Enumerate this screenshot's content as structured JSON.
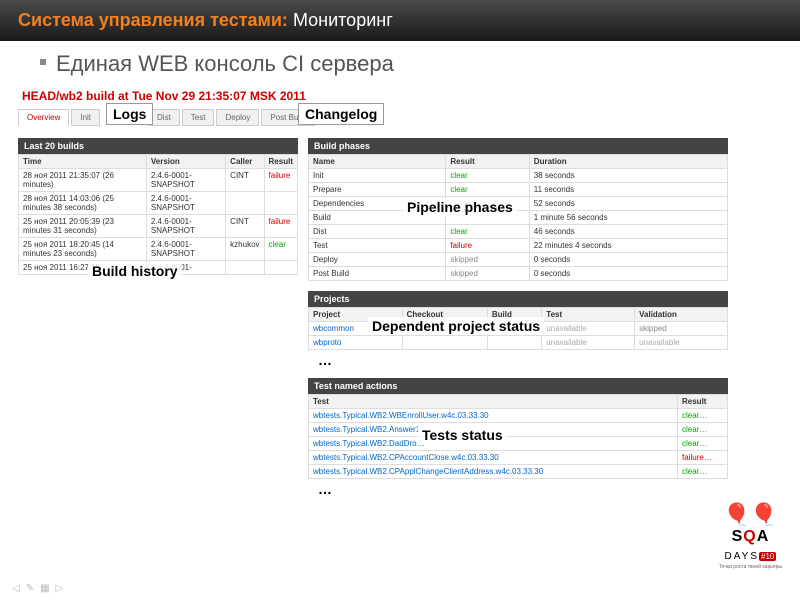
{
  "slide": {
    "title_orange": "Система управления тестами:",
    "title_white": "Мониторинг",
    "subtitle": "Единая WEB консоль CI сервера"
  },
  "build_title": "HEAD/wb2 build at Tue Nov 29 21:35:07 MSK 2011",
  "tabs": [
    "Overview",
    "Init",
    "Logs",
    "Dist",
    "Test",
    "Deploy",
    "Post Build",
    "Changelog"
  ],
  "callouts": {
    "logs": "Logs",
    "changelog": "Changelog",
    "build_history": "Build history",
    "pipeline_phases": "Pipeline phases",
    "dependent_projects": "Dependent project status",
    "tests_status": "Tests status"
  },
  "build_history": {
    "header": "Last 20 builds",
    "cols": [
      "Time",
      "Version",
      "Caller",
      "Result"
    ],
    "rows": [
      {
        "time": "28 ноя 2011 21:35:07 (26 minutes)",
        "version": "2.4.6-0001-SNAPSHOT",
        "caller": "CINT",
        "result": "failure",
        "rc": "r-failure"
      },
      {
        "time": "28 ноя 2011 14:03:06 (25 minutes 38 seconds)",
        "version": "2.4.6-0001-SNAPSHOT",
        "caller": "",
        "result": "",
        "rc": ""
      },
      {
        "time": "25 ноя 2011 20:05:39 (23 minutes 31 seconds)",
        "version": "2.4.6-0001-SNAPSHOT",
        "caller": "CINT",
        "result": "failure",
        "rc": "r-failure"
      },
      {
        "time": "25 ноя 2011 18:20:45 (14 minutes 23 seconds)",
        "version": "2.4.6-0001-SNAPSHOT",
        "caller": "kzhukov",
        "result": "clear",
        "rc": "r-clear"
      },
      {
        "time": "25 ноя 2011 16:27:18",
        "version": "2.4.6-0001-",
        "caller": "",
        "result": "",
        "rc": ""
      }
    ]
  },
  "phases": {
    "header": "Build phases",
    "cols": [
      "Name",
      "Result",
      "Duration"
    ],
    "rows": [
      {
        "name": "Init",
        "result": "clear",
        "rc": "r-clear",
        "duration": "38 seconds"
      },
      {
        "name": "Prepare",
        "result": "clear",
        "rc": "r-clear",
        "duration": "11 seconds"
      },
      {
        "name": "Dependencies",
        "result": "",
        "rc": "",
        "duration": "52 seconds"
      },
      {
        "name": "Build",
        "result": "",
        "rc": "",
        "duration": "1 minute 56 seconds"
      },
      {
        "name": "Dist",
        "result": "clear",
        "rc": "r-clear",
        "duration": "46 seconds"
      },
      {
        "name": "Test",
        "result": "failure",
        "rc": "r-failure",
        "duration": "22 minutes 4 seconds"
      },
      {
        "name": "Deploy",
        "result": "skipped",
        "rc": "r-skipped",
        "duration": "0 seconds"
      },
      {
        "name": "Post Build",
        "result": "skipped",
        "rc": "r-skipped",
        "duration": "0 seconds"
      }
    ]
  },
  "projects": {
    "header": "Projects",
    "cols": [
      "Project",
      "Checkout",
      "Build",
      "Test",
      "Validation"
    ],
    "rows": [
      {
        "project": "wbcommon",
        "pc": "r-link",
        "checkout": "",
        "build": "",
        "test": "unavailable",
        "tc": "r-unavailable",
        "validation": "skipped",
        "vc": "r-skipped"
      },
      {
        "project": "wbproto",
        "pc": "r-link",
        "checkout": "",
        "build": "",
        "test": "unavailable",
        "tc": "r-unavailable",
        "validation": "unavailable",
        "vc": "r-unavailable"
      }
    ],
    "ellipsis": "…"
  },
  "tests": {
    "header": "Test named actions",
    "cols": [
      "Test",
      "Result"
    ],
    "rows": [
      {
        "test": "wbtests.Typical.WB2.WBEnrollUser.w4c.03.33.30",
        "tc": "r-link",
        "result": "clear…",
        "rc": "r-clear"
      },
      {
        "test": "wbtests.Typical.WB2.Answer1",
        "tc": "r-link",
        "result": "clear…",
        "rc": "r-clear"
      },
      {
        "test": "wbtests.Typical.WB2.DadDro…",
        "tc": "r-link",
        "result": "clear…",
        "rc": "r-clear"
      },
      {
        "test": "wbtests.Typical.WB2.CPAccountClose.w4c.03.33.30",
        "tc": "r-link",
        "result": "failure…",
        "rc": "r-failure"
      },
      {
        "test": "wbtests.Typical.WB2.CPApplChangeClientAddress.w4c.03.33.30",
        "tc": "r-link",
        "result": "clear…",
        "rc": "r-clear"
      }
    ],
    "ellipsis": "…"
  },
  "logo": {
    "sqa_s": "S",
    "sqa_q": "Q",
    "sqa_a": "A",
    "days": "DAYS",
    "ten": "#10",
    "sub": "Точка роста твоей карьеры"
  }
}
